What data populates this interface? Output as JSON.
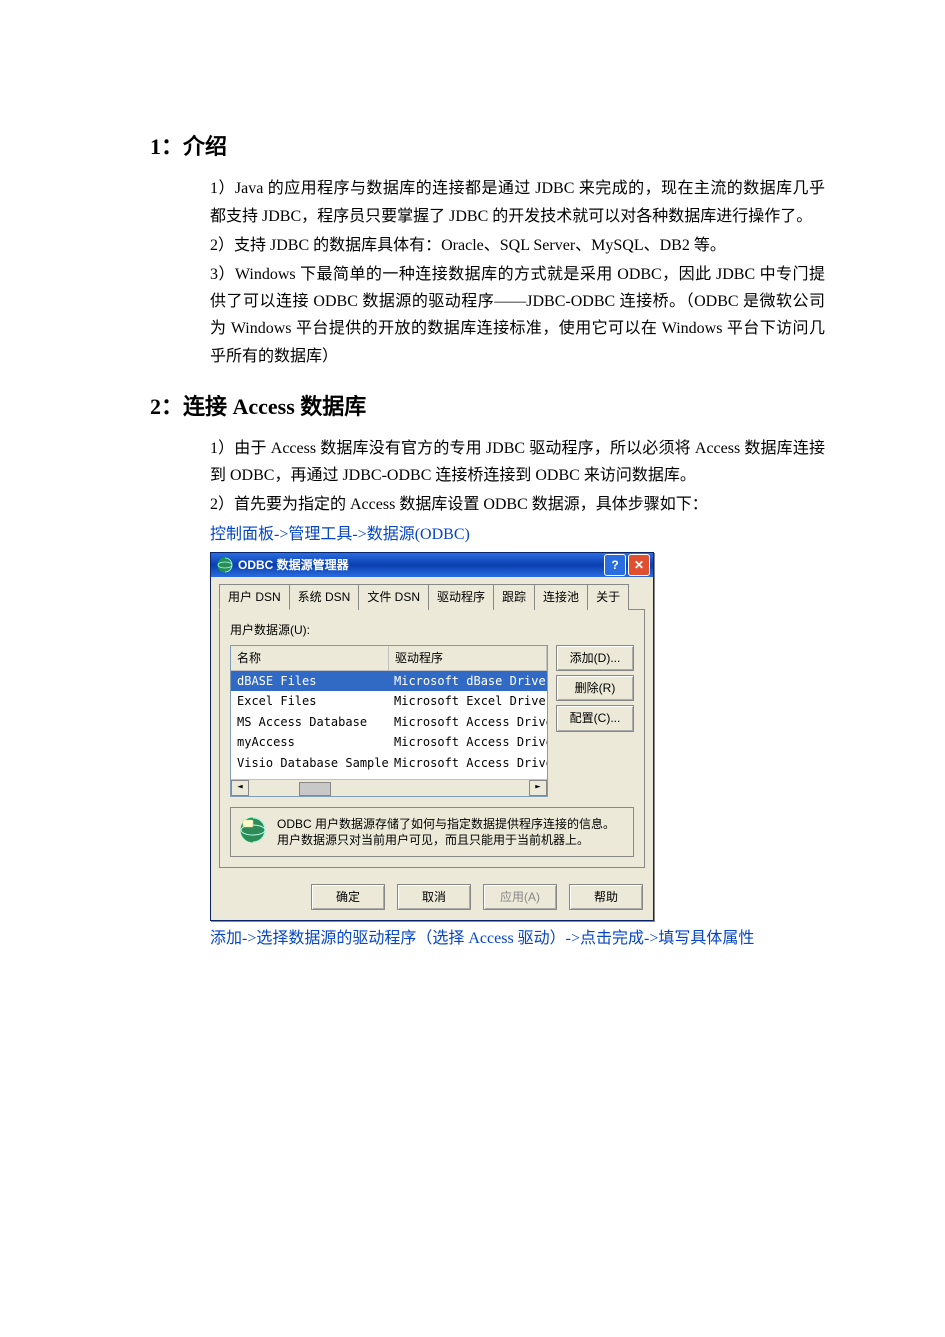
{
  "section1": {
    "heading": "1：介绍",
    "items": [
      "1）Java 的应用程序与数据库的连接都是通过 JDBC 来完成的，现在主流的数据库几乎都支持 JDBC，程序员只要掌握了 JDBC 的开发技术就可以对各种数据库进行操作了。",
      "2）支持 JDBC 的数据库具体有：Oracle、SQL Server、MySQL、DB2 等。",
      "3）Windows 下最简单的一种连接数据库的方式就是采用 ODBC，因此 JDBC 中专门提供了可以连接 ODBC 数据源的驱动程序——JDBC-ODBC 连接桥。（ODBC 是微软公司为 Windows 平台提供的开放的数据库连接标准，使用它可以在 Windows 平台下访问几乎所有的数据库）"
    ]
  },
  "section2": {
    "heading": "2：连接 Access 数据库",
    "items": [
      "1）由于 Access 数据库没有官方的专用 JDBC 驱动程序，所以必须将 Access 数据库连接到 ODBC，再通过 JDBC-ODBC 连接桥连接到 ODBC 来访问数据库。",
      "2）首先要为指定的 Access 数据库设置 ODBC 数据源，具体步骤如下："
    ],
    "link1": "控制面板->管理工具->数据源(ODBC)",
    "link2": "添加->选择数据源的驱动程序（选择 Access 驱动）->点击完成->填写具体属性"
  },
  "odbc": {
    "title": "ODBC 数据源管理器",
    "help": "?",
    "close": "✕",
    "tabs": [
      "用户 DSN",
      "系统 DSN",
      "文件 DSN",
      "驱动程序",
      "跟踪",
      "连接池",
      "关于"
    ],
    "groupLabel": "用户数据源(U):",
    "cols": {
      "name": "名称",
      "driver": "驱动程序"
    },
    "rows": [
      {
        "name": "dBASE Files",
        "driver": "Microsoft dBase Driver (*.dbf)",
        "selected": true
      },
      {
        "name": "Excel Files",
        "driver": "Microsoft Excel Driver (*.xls)",
        "selected": false
      },
      {
        "name": "MS Access Database",
        "driver": "Microsoft Access Driver (*.mdb",
        "selected": false
      },
      {
        "name": "myAccess",
        "driver": "Microsoft Access Driver (*.mdb",
        "selected": false
      },
      {
        "name": "Visio Database Samples",
        "driver": "Microsoft Access Driver (*.MDB",
        "selected": false
      }
    ],
    "sideButtons": {
      "add": "添加(D)...",
      "remove": "删除(R)",
      "config": "配置(C)..."
    },
    "info": "ODBC 用户数据源存储了如何与指定数据提供程序连接的信息。用户数据源只对当前用户可见，而且只能用于当前机器上。",
    "dlg": {
      "ok": "确定",
      "cancel": "取消",
      "apply": "应用(A)",
      "help": "帮助"
    }
  }
}
